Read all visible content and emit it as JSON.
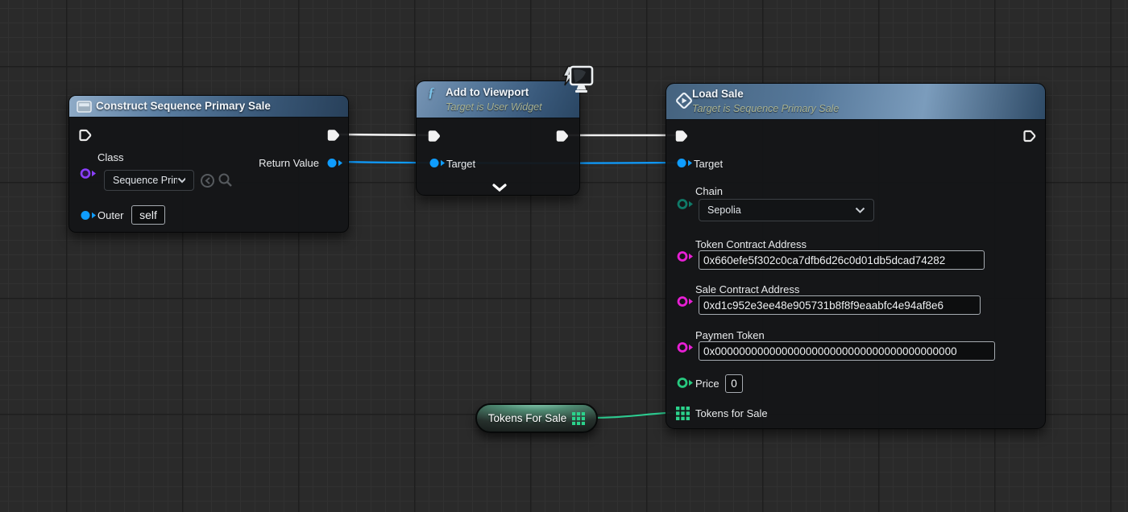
{
  "construct_node": {
    "title": "Construct Sequence Primary Sale",
    "class_label": "Class",
    "class_value": "Sequence Prima",
    "return_label": "Return Value",
    "outer_label": "Outer",
    "outer_value": "self"
  },
  "viewport_node": {
    "title": "Add to Viewport",
    "subtitle": "Target is User Widget",
    "target_label": "Target"
  },
  "load_sale_node": {
    "title": "Load Sale",
    "subtitle": "Target is Sequence Primary Sale",
    "target_label": "Target",
    "fields": [
      {
        "label": "Chain",
        "value": "Sepolia"
      },
      {
        "label": "Token Contract Address",
        "value": "0x660efe5f302c0ca7dfb6d26c0d01db5dcad74282"
      },
      {
        "label": "Sale Contract Address",
        "value": "0xd1c952e3ee48e905731b8f8f9eaabfc4e94af8e6"
      },
      {
        "label": "Paymen Token",
        "value": "0x0000000000000000000000000000000000000000"
      },
      {
        "label": "Price",
        "value": "0"
      },
      {
        "label": "Tokens for Sale"
      }
    ]
  },
  "tokens_variable": {
    "label": "Tokens For Sale"
  },
  "colors": {
    "exec_wire": "#f2f2f2",
    "object_wire": "#0f9dff",
    "array_wire": "#2dc98f",
    "class_pin": "#8a3ffc",
    "enum_pin": "#0f7a68",
    "string_pin": "#e71fd4",
    "int_pin": "#27c97f"
  }
}
